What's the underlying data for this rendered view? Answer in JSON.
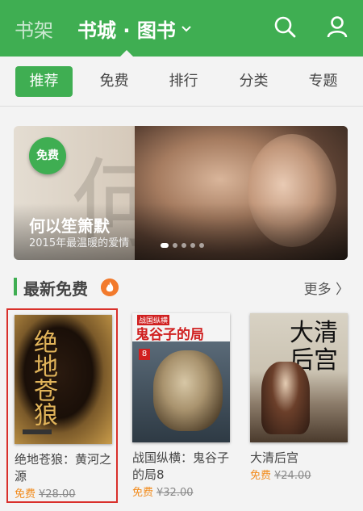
{
  "header": {
    "shelf_label": "书架",
    "store_label": "书城 · 图书"
  },
  "tabs": [
    {
      "label": "推荐",
      "active": true
    },
    {
      "label": "免费",
      "active": false
    },
    {
      "label": "排行",
      "active": false
    },
    {
      "label": "分类",
      "active": false
    },
    {
      "label": "专题",
      "active": false
    }
  ],
  "banner": {
    "badge": "免费",
    "title": "何以笙箫默",
    "subtitle": "2015年最温暖的爱情",
    "bg_char": "何",
    "slide_count": 5,
    "active_slide": 0
  },
  "section": {
    "title": "最新免费",
    "more_label": "更多 〉"
  },
  "books": [
    {
      "title": "绝地苍狼：黄河之源",
      "free_label": "免费",
      "old_price": "¥28.00",
      "selected": true,
      "cover_text": "绝地苍狼"
    },
    {
      "title": "战国纵横：鬼谷子的局8",
      "free_label": "免费",
      "old_price": "¥32.00",
      "selected": false,
      "cover_text": "鬼谷子的局",
      "cover_top": "战国纵横",
      "cover_num": "8"
    },
    {
      "title": "大清后宫",
      "free_label": "免费",
      "old_price": "¥24.00",
      "selected": false,
      "cover_text": "大清后宫"
    }
  ],
  "colors": {
    "accent": "#3fae52",
    "price_free": "#f28b1c",
    "selection": "#d9302b"
  }
}
